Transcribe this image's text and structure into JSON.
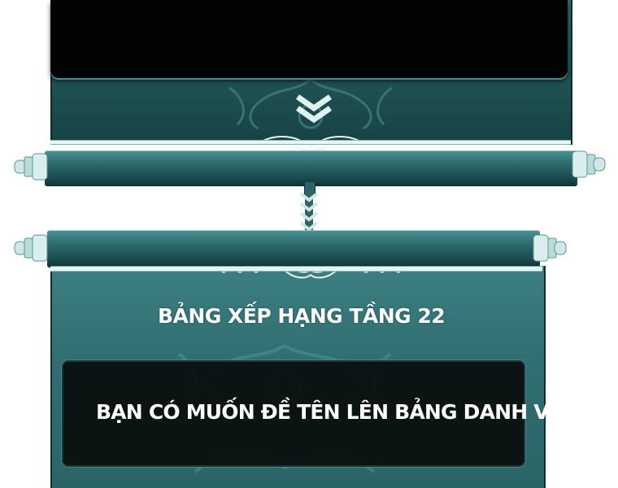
{
  "colors": {
    "panel_teal": "#2f6e71",
    "panel_dark": "#174244",
    "screen_black": "#030303",
    "rail_white": "#eaf6f5",
    "text_white": "#ffffff"
  },
  "icons": {
    "top_chevron": "double-chevron-down-icon",
    "connector_arrows": "triple-chevron-down-icon",
    "ornament": "scroll-ornament-icon"
  },
  "ranking_board": {
    "title": "BẢNG XẾP HẠNG TẦNG 22"
  },
  "dialog": {
    "question": "BẠN CÓ MUỐN ĐỀ TÊN LÊN BẢNG DANH VỌNG?"
  }
}
